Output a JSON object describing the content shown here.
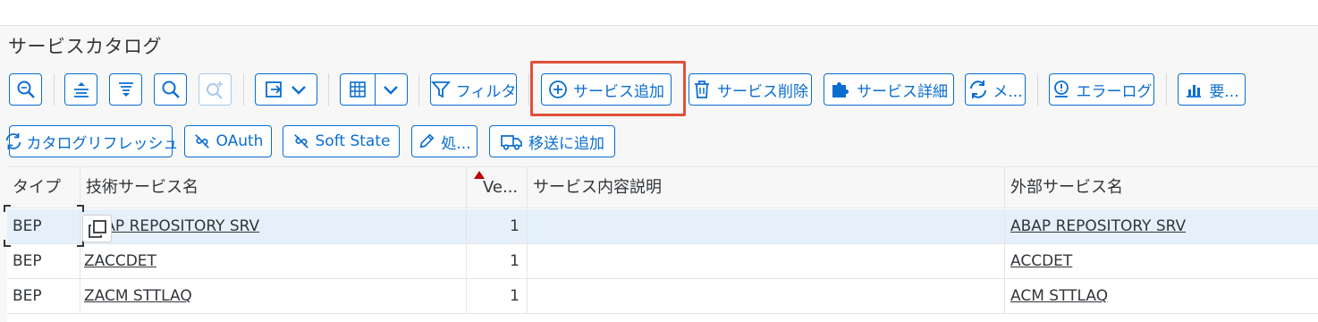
{
  "title": "サービスカタログ",
  "toolbar_row1": {
    "filter_label": "フィルタ",
    "add_service_label": "サービス追加",
    "delete_service_label": "サービス削除",
    "service_details_label": "サービス詳細",
    "refresh_short_label": "メ...",
    "error_log_label": "エラーログ",
    "summary_label": "要..."
  },
  "toolbar_row2": {
    "catalog_refresh_label": "カタログリフレッシュ",
    "oauth_label": "OAuth",
    "soft_state_label": "Soft State",
    "process_label": "処...",
    "add_to_transport_label": "移送に追加"
  },
  "table": {
    "columns": [
      "タイプ",
      "技術サービス名",
      "Ve...",
      "サービス内容説明",
      "外部サービス名"
    ],
    "rows": [
      {
        "type": "BEP",
        "tech_name": "ABAP REPOSITORY SRV",
        "version": "1",
        "description": "",
        "external_name": "ABAP REPOSITORY SRV"
      },
      {
        "type": "BEP",
        "tech_name": "ZACCDET",
        "version": "1",
        "description": "",
        "external_name": "ACCDET"
      },
      {
        "type": "BEP",
        "tech_name": "ZACM STTLAQ",
        "version": "1",
        "description": "",
        "external_name": "ACM STTLAQ"
      }
    ]
  },
  "colors": {
    "accent": "#0a6ed1",
    "highlight_box": "#e0503a",
    "sort_indicator": "#bb0000",
    "selected_row": "#e5f0fa"
  }
}
